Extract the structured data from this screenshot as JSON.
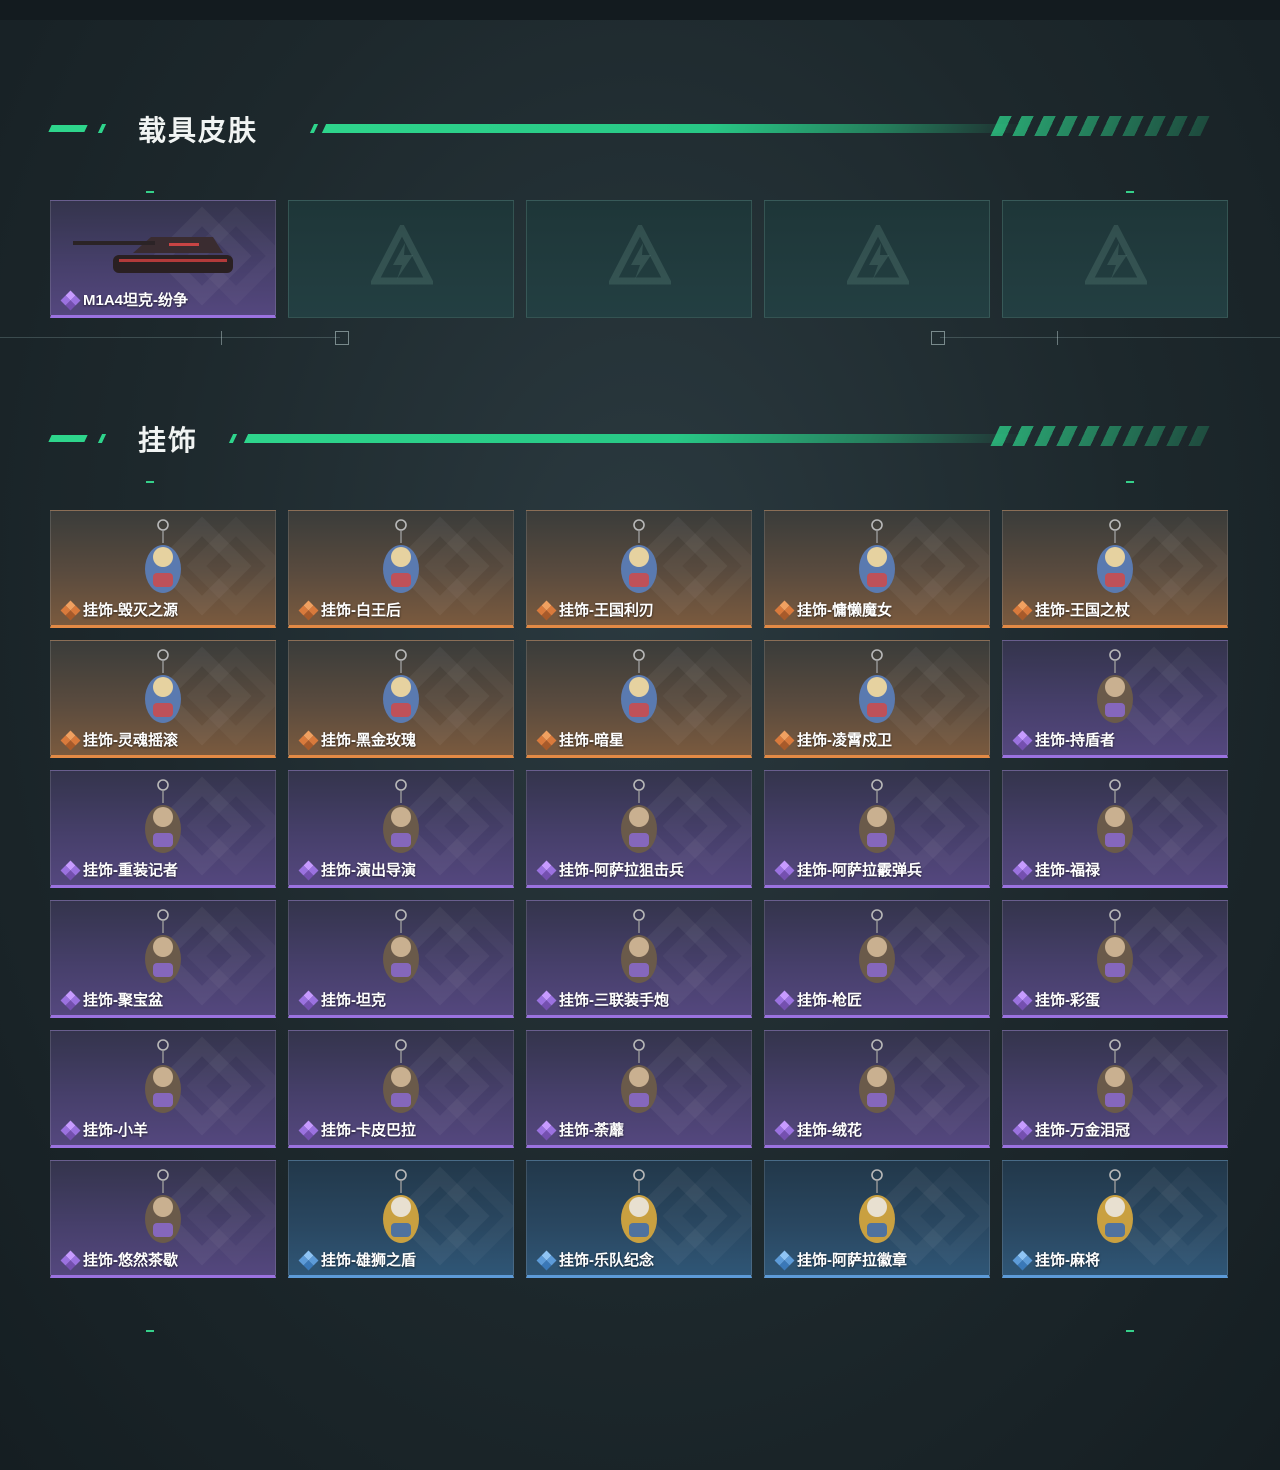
{
  "sections": [
    {
      "title": "载具皮肤",
      "items": [
        {
          "label": "M1A4坦克-纷争",
          "rarity": "purple",
          "icon": "tank-icon"
        },
        {
          "label": "",
          "rarity": "empty"
        },
        {
          "label": "",
          "rarity": "empty"
        },
        {
          "label": "",
          "rarity": "empty"
        },
        {
          "label": "",
          "rarity": "empty"
        }
      ]
    },
    {
      "title": "挂饰",
      "items": [
        {
          "label": "挂饰-毁灭之源",
          "rarity": "orange",
          "icon": "dragon-icon"
        },
        {
          "label": "挂饰-白王后",
          "rarity": "orange",
          "icon": "queen-figure-icon"
        },
        {
          "label": "挂饰-王国利刃",
          "rarity": "orange",
          "icon": "knight-figure-icon"
        },
        {
          "label": "挂饰-慵懒魔女",
          "rarity": "orange",
          "icon": "witch-figure-icon"
        },
        {
          "label": "挂饰-王国之杖",
          "rarity": "orange",
          "icon": "scepter-figure-icon"
        },
        {
          "label": "挂饰-灵魂摇滚",
          "rarity": "orange",
          "icon": "guitarist-figure-icon"
        },
        {
          "label": "挂饰-黑金玫瑰",
          "rarity": "orange",
          "icon": "black-rose-icon"
        },
        {
          "label": "挂饰-暗星",
          "rarity": "orange",
          "icon": "dark-star-icon"
        },
        {
          "label": "挂饰-凌霄戍卫",
          "rarity": "orange",
          "icon": "rocket-icon"
        },
        {
          "label": "挂饰-持盾者",
          "rarity": "purple",
          "icon": "shield-bearer-icon"
        },
        {
          "label": "挂饰-重装记者",
          "rarity": "purple",
          "icon": "reporter-figure-icon"
        },
        {
          "label": "挂饰-演出导演",
          "rarity": "purple",
          "icon": "director-figure-icon"
        },
        {
          "label": "挂饰-阿萨拉狙击兵",
          "rarity": "purple",
          "icon": "sniper-figure-icon"
        },
        {
          "label": "挂饰-阿萨拉霰弹兵",
          "rarity": "purple",
          "icon": "shotgunner-figure-icon"
        },
        {
          "label": "挂饰-福禄",
          "rarity": "purple",
          "icon": "gourd-icon"
        },
        {
          "label": "挂饰-聚宝盆",
          "rarity": "purple",
          "icon": "treasure-bowl-icon"
        },
        {
          "label": "挂饰-坦克",
          "rarity": "purple",
          "icon": "tank-charm-icon"
        },
        {
          "label": "挂饰-三联装手炮",
          "rarity": "purple",
          "icon": "hand-cannon-icon"
        },
        {
          "label": "挂饰-枪匠",
          "rarity": "purple",
          "icon": "gunsmith-icon"
        },
        {
          "label": "挂饰-彩蛋",
          "rarity": "purple",
          "icon": "easter-egg-icon"
        },
        {
          "label": "挂饰-小羊",
          "rarity": "purple",
          "icon": "lamb-icon"
        },
        {
          "label": "挂饰-卡皮巴拉",
          "rarity": "purple",
          "icon": "capybara-icon"
        },
        {
          "label": "挂饰-荼蘼",
          "rarity": "purple",
          "icon": "flower-icon"
        },
        {
          "label": "挂饰-绒花",
          "rarity": "purple",
          "icon": "red-flower-icon"
        },
        {
          "label": "挂饰-万金泪冠",
          "rarity": "purple",
          "icon": "crown-icon"
        },
        {
          "label": "挂饰-悠然茶歇",
          "rarity": "purple",
          "icon": "cupcake-icon"
        },
        {
          "label": "挂饰-雄狮之盾",
          "rarity": "blue",
          "icon": "lion-shield-icon"
        },
        {
          "label": "挂饰-乐队纪念",
          "rarity": "blue",
          "icon": "band-badge-icon"
        },
        {
          "label": "挂饰-阿萨拉徽章",
          "rarity": "blue",
          "icon": "emblem-icon"
        },
        {
          "label": "挂饰-麻将",
          "rarity": "blue",
          "icon": "mahjong-icon"
        }
      ]
    }
  ],
  "colors": {
    "accent": "#2ed58c",
    "orange": "#e38a45",
    "purple": "#9b72e0",
    "blue": "#5d9bd8"
  }
}
